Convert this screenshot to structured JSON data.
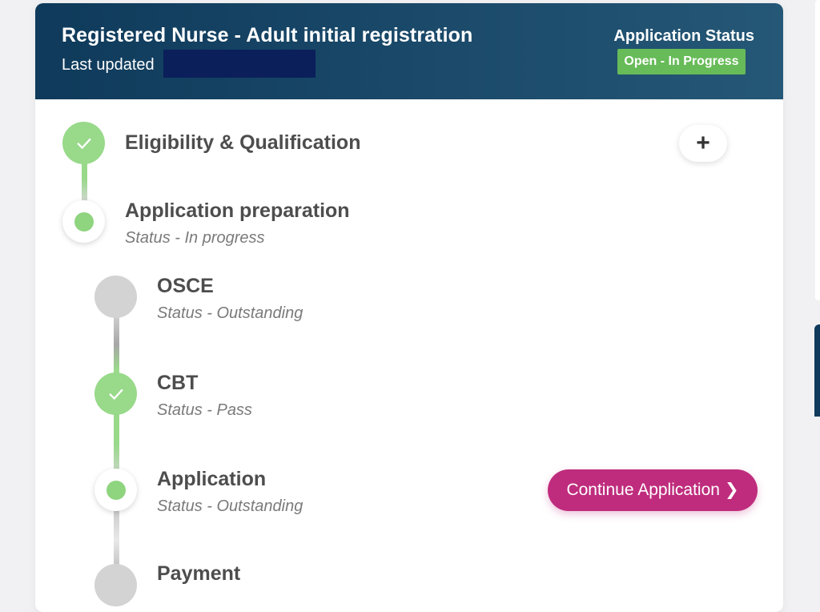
{
  "header": {
    "title": "Registered Nurse - Adult initial registration",
    "last_updated_label": "Last updated",
    "status_label": "Application Status",
    "status_badge": "Open - In Progress"
  },
  "steps": [
    {
      "title": "Eligibility & Qualification",
      "state": "done"
    },
    {
      "title": "Application preparation",
      "status": "Status - In progress",
      "state": "active"
    },
    {
      "title": "OSCE",
      "status": "Status - Outstanding",
      "state": "pending"
    },
    {
      "title": "CBT",
      "status": "Status - Pass",
      "state": "done"
    },
    {
      "title": "Application",
      "status": "Status - Outstanding",
      "state": "active"
    },
    {
      "title": "Payment",
      "state": "pending"
    }
  ],
  "buttons": {
    "expand": "+",
    "continue": "Continue Application"
  },
  "colors": {
    "header_dark": "#0f3a5b",
    "badge_green": "#67bb58",
    "node_green": "#98d98a",
    "continue_pink": "#bf2c7d"
  },
  "icons": {
    "check": "check-icon",
    "chevron": "chevron-right-icon"
  }
}
